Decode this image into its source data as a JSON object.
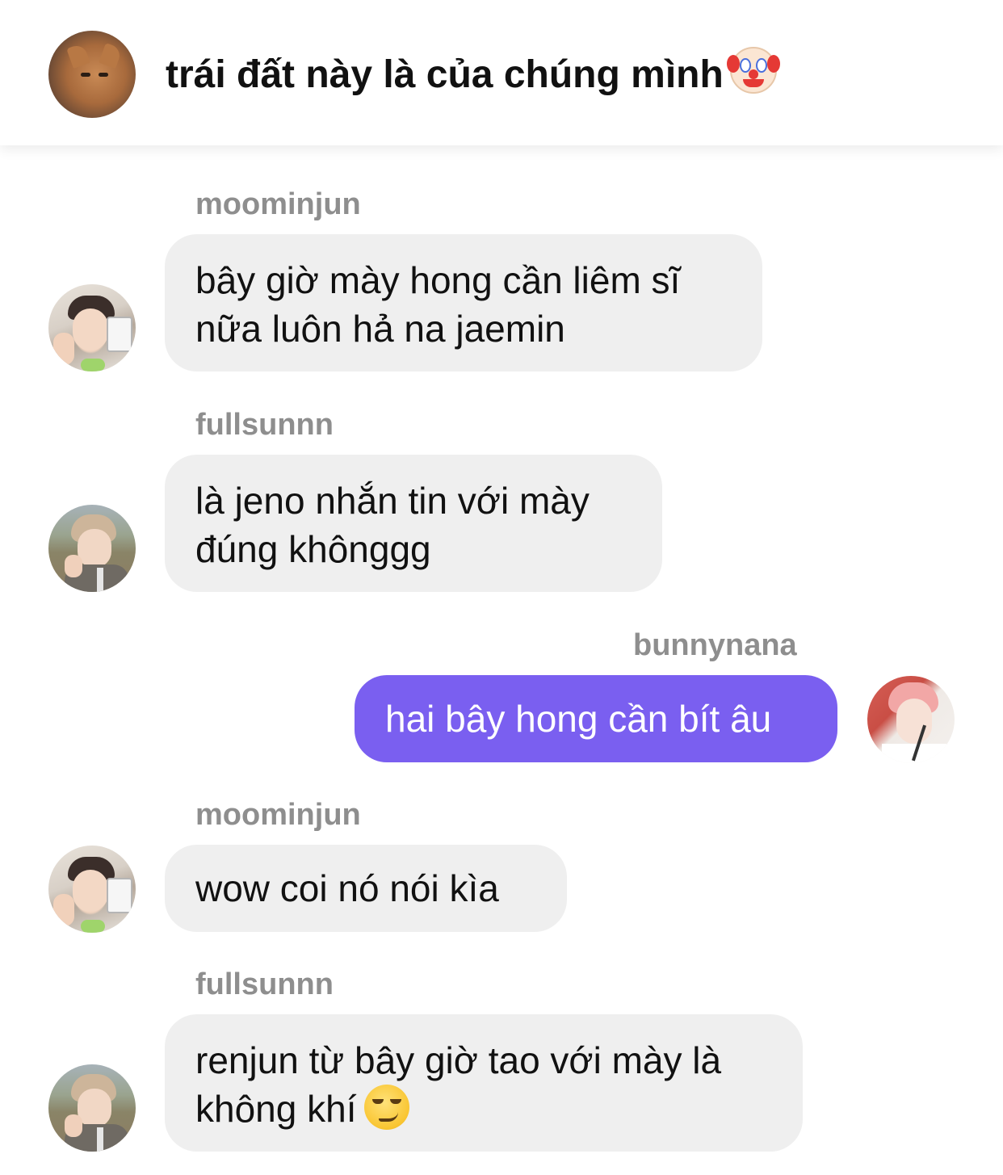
{
  "header": {
    "title": "trái đất này là của chúng mình",
    "title_emoji": "clown-face-emoji",
    "avatar": "cat-avatar"
  },
  "colors": {
    "incoming_bubble": "#efefef",
    "outgoing_bubble": "#7a5ff0",
    "username_text": "#8e8e8e"
  },
  "messages": [
    {
      "sender": "moominjun",
      "text": "bây giờ mày hong cần liêm sĩ nữa luôn hả na jaemin",
      "outgoing": false
    },
    {
      "sender": "fullsunnn",
      "text": "là jeno nhắn tin với mày đúng khônggg",
      "outgoing": false
    },
    {
      "sender": "bunnynana",
      "text": "hai bây hong cần bít âu",
      "outgoing": true
    },
    {
      "sender": "moominjun",
      "text": "wow coi nó nói kìa",
      "outgoing": false
    },
    {
      "sender": "fullsunnn",
      "text": "renjun từ bây giờ tao với mày là không khí",
      "emoji": "smirking-face-emoji",
      "outgoing": false
    }
  ]
}
